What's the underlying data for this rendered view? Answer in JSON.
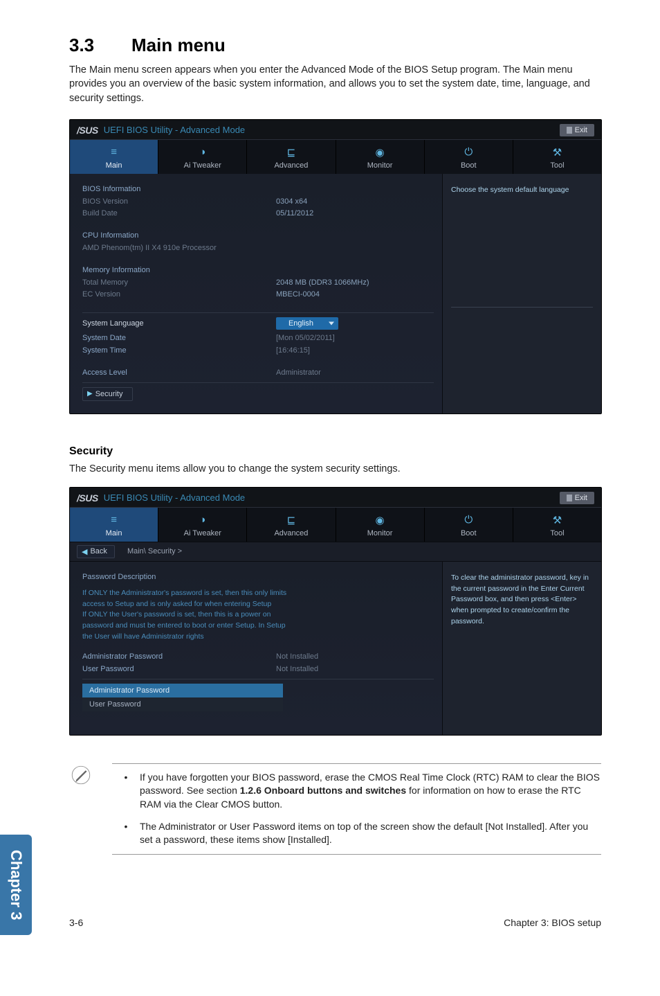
{
  "section": {
    "number": "3.3",
    "title": "Main menu"
  },
  "intro": "The Main menu screen appears when you enter the Advanced Mode of the BIOS Setup program. The Main menu provides you an overview of the basic system information, and allows you to set the system date, time, language, and security settings.",
  "bios_common": {
    "logo": "/SUS",
    "title": "UEFI BIOS Utility - Advanced Mode",
    "exit": "Exit",
    "tabs": [
      "Main",
      "Ai Tweaker",
      "Advanced",
      "Monitor",
      "Boot",
      "Tool"
    ]
  },
  "bios1": {
    "active_tab": 0,
    "help": "Choose the system default language",
    "groups": {
      "bios_info": {
        "title": "BIOS Information",
        "rows": [
          {
            "k": "BIOS Version",
            "v": "0304 x64"
          },
          {
            "k": "Build Date",
            "v": "05/11/2012"
          }
        ]
      },
      "cpu_info": {
        "title": "CPU Information",
        "line": "AMD Phenom(tm) II X4 910e Processor"
      },
      "mem_info": {
        "title": "Memory Information",
        "rows": [
          {
            "k": "Total Memory",
            "v": "2048 MB (DDR3 1066MHz)"
          },
          {
            "k": "EC Version",
            "v": "MBECI-0004"
          }
        ]
      }
    },
    "fields": {
      "language": {
        "label": "System Language",
        "value": "English"
      },
      "date": {
        "label": "System Date",
        "value": "[Mon 05/02/2011]"
      },
      "time": {
        "label": "System Time",
        "value": "[16:46:15]"
      },
      "access": {
        "label": "Access Level",
        "value": "Administrator"
      },
      "security": "Security"
    }
  },
  "security_section": {
    "heading": "Security",
    "text": "The Security menu items allow you to change the system security settings."
  },
  "bios2": {
    "active_tab": 0,
    "back": "Back",
    "breadcrumb": "Main\\ Security  >",
    "help": "To clear the administrator password, key in the current password in the Enter Current Password box, and then press <Enter> when prompted to create/confirm the password.",
    "pw_desc_title": "Password Description",
    "pw_desc_text": "If ONLY the Administrator's password is set, then this only limits access to Setup and is only asked for when entering Setup\nIf ONLY the User's password is set, then this is a power on password and must be entered to boot or enter Setup. In Setup the User will have Administrator rights",
    "rows": [
      {
        "k": "Administrator Password",
        "v": "Not Installed"
      },
      {
        "k": "User Password",
        "v": "Not Installed"
      }
    ],
    "hl": "Administrator Password",
    "sub": "User Password"
  },
  "notes": [
    "If you have forgotten your BIOS password, erase the CMOS Real Time Clock (RTC) RAM to clear the BIOS password. See section 1.2.6 Onboard buttons and switches for information on how to erase the RTC RAM via the Clear CMOS button.",
    "The Administrator or User Password items on top of the screen show the default [Not Installed]. After you set a password, these items show [Installed]."
  ],
  "chapter_tab": "Chapter 3",
  "footer": {
    "left": "3-6",
    "right": "Chapter 3: BIOS setup"
  }
}
